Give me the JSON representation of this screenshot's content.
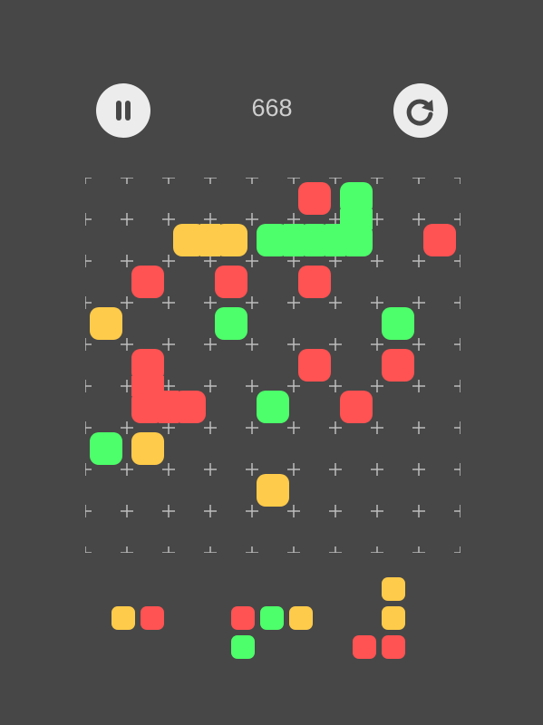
{
  "score": "668",
  "colors": {
    "background": "#474747",
    "red": "#ff5252",
    "green": "#4dff6a",
    "yellow": "#ffcb4a",
    "button": "#ececec",
    "grid_line": "#bdbdbd"
  },
  "controls": {
    "pause_icon": "pause-icon",
    "restart_icon": "restart-icon"
  },
  "board": {
    "rows": 9,
    "cols": 9,
    "pieces": [
      {
        "color": "red",
        "cells": [
          [
            0,
            5
          ]
        ]
      },
      {
        "color": "green",
        "cells": [
          [
            0,
            6
          ],
          [
            1,
            6
          ],
          [
            1,
            5
          ],
          [
            1,
            4
          ]
        ]
      },
      {
        "color": "yellow",
        "cells": [
          [
            1,
            2
          ],
          [
            1,
            3
          ]
        ]
      },
      {
        "color": "red",
        "cells": [
          [
            1,
            8
          ]
        ]
      },
      {
        "color": "red",
        "cells": [
          [
            2,
            1
          ]
        ]
      },
      {
        "color": "red",
        "cells": [
          [
            2,
            3
          ]
        ]
      },
      {
        "color": "red",
        "cells": [
          [
            2,
            5
          ]
        ]
      },
      {
        "color": "yellow",
        "cells": [
          [
            3,
            0
          ]
        ]
      },
      {
        "color": "green",
        "cells": [
          [
            3,
            3
          ]
        ]
      },
      {
        "color": "green",
        "cells": [
          [
            3,
            7
          ]
        ]
      },
      {
        "color": "red",
        "cells": [
          [
            4,
            1
          ],
          [
            5,
            1
          ],
          [
            5,
            2
          ]
        ]
      },
      {
        "color": "red",
        "cells": [
          [
            4,
            5
          ]
        ]
      },
      {
        "color": "red",
        "cells": [
          [
            4,
            7
          ]
        ]
      },
      {
        "color": "green",
        "cells": [
          [
            5,
            4
          ]
        ]
      },
      {
        "color": "red",
        "cells": [
          [
            5,
            6
          ]
        ]
      },
      {
        "color": "green",
        "cells": [
          [
            6,
            0
          ]
        ]
      },
      {
        "color": "yellow",
        "cells": [
          [
            6,
            1
          ]
        ]
      },
      {
        "color": "yellow",
        "cells": [
          [
            7,
            4
          ]
        ]
      }
    ]
  },
  "tray": [
    {
      "cells": [
        {
          "r": 0,
          "c": 0,
          "color": "yellow"
        },
        {
          "r": 0,
          "c": 1,
          "color": "red"
        }
      ]
    },
    {
      "cells": [
        {
          "r": 0,
          "c": 0,
          "color": "red"
        },
        {
          "r": 0,
          "c": 1,
          "color": "green"
        },
        {
          "r": 0,
          "c": 2,
          "color": "yellow"
        },
        {
          "r": 1,
          "c": 0,
          "color": "green"
        }
      ]
    },
    {
      "cells": [
        {
          "r": 0,
          "c": 1,
          "color": "yellow"
        },
        {
          "r": 1,
          "c": 1,
          "color": "yellow"
        },
        {
          "r": 2,
          "c": 0,
          "color": "red"
        },
        {
          "r": 2,
          "c": 1,
          "color": "red"
        }
      ]
    }
  ]
}
